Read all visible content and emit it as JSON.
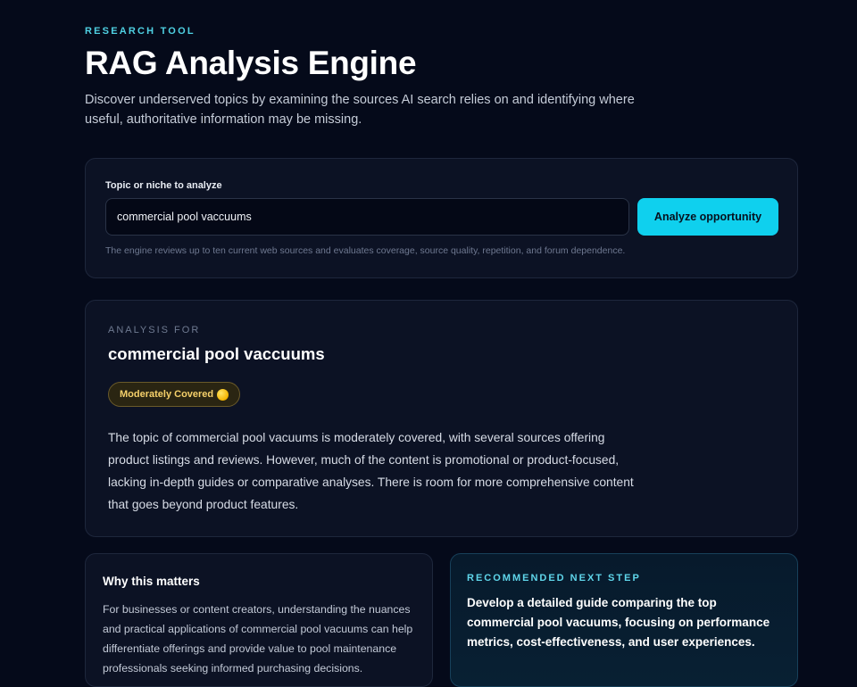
{
  "header": {
    "eyebrow": "RESEARCH TOOL",
    "title": "RAG Analysis Engine",
    "subtitle": "Discover underserved topics by examining the sources AI search relies on and identifying where useful, authoritative information may be missing."
  },
  "search": {
    "label": "Topic or niche to analyze",
    "value": "commercial pool vaccuums",
    "button_label": "Analyze opportunity",
    "hint": "The engine reviews up to ten current web sources and evaluates coverage, source quality, repetition, and forum dependence."
  },
  "result": {
    "eyebrow": "ANALYSIS FOR",
    "topic": "commercial pool vaccuums",
    "badge": {
      "label": "Moderately Covered",
      "icon": "yellow-circle-icon",
      "color": "#f5d06a"
    },
    "summary": "The topic of commercial pool vacuums is moderately covered, with several sources offering product listings and reviews. However, much of the content is promotional or product-focused, lacking in-depth guides or comparative analyses. There is room for more comprehensive content that goes beyond product features."
  },
  "why": {
    "title": "Why this matters",
    "body": "For businesses or content creators, understanding the nuances and practical applications of commercial pool vacuums can help differentiate offerings and provide value to pool maintenance professionals seeking informed purchasing decisions."
  },
  "next_step": {
    "eyebrow": "RECOMMENDED NEXT STEP",
    "body": "Develop a detailed guide comparing the top commercial pool vacuums, focusing on performance metrics, cost-effectiveness, and user experiences."
  },
  "colors": {
    "background": "#050a1a",
    "accent": "#0fd0ee",
    "card": "#0c1224"
  }
}
